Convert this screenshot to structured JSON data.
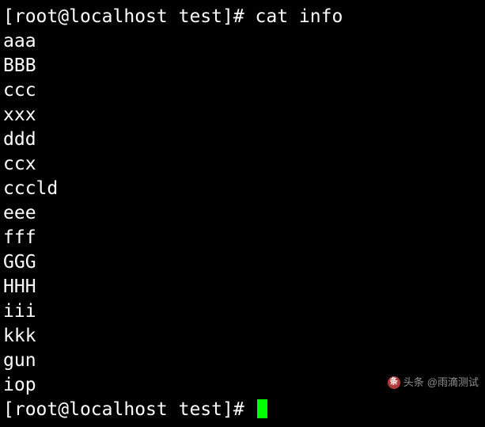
{
  "prompt1": {
    "open": "[",
    "user": "root",
    "at": "@",
    "host": "localhost",
    "space": " ",
    "path": "test",
    "close": "]# ",
    "command": "cat info"
  },
  "output_lines": [
    "aaa",
    "BBB",
    "ccc",
    "xxx",
    "ddd",
    "ccx",
    "cccld",
    "eee",
    "fff",
    "GGG",
    "HHH",
    "iii",
    "kkk",
    "gun",
    "iop"
  ],
  "prompt2": {
    "open": "[",
    "user": "root",
    "at": "@",
    "host": "localhost",
    "space": " ",
    "path": "test",
    "close": "]# "
  },
  "watermark": {
    "prefix": "头条",
    "handle": "@雨滴测试"
  }
}
